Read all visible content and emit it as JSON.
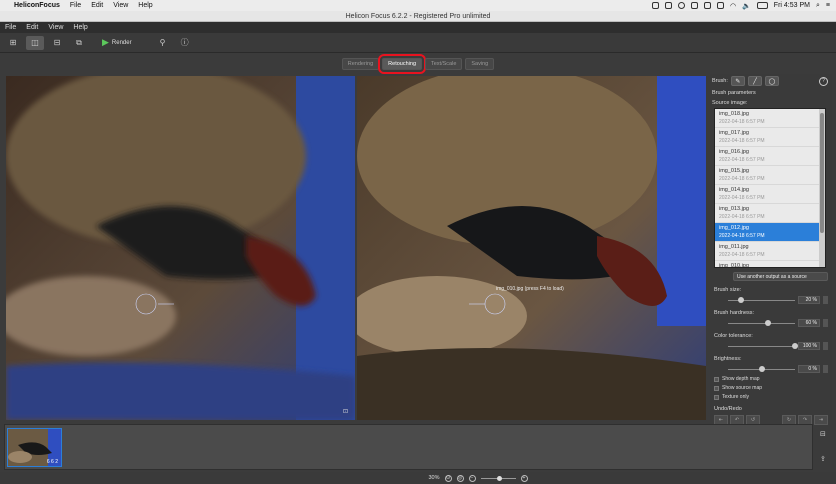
{
  "mac_menubar": {
    "app_name": "HeliconFocus",
    "menus": [
      "File",
      "Edit",
      "View",
      "Help"
    ],
    "clock": "Fri 4:53 PM"
  },
  "window": {
    "title": "Helicon Focus 6.2.2 - Registered Pro unlimited"
  },
  "app_menu": [
    "File",
    "Edit",
    "View",
    "Help"
  ],
  "toolbar": {
    "render_label": "Render"
  },
  "tabs": [
    {
      "label": "Rendering"
    },
    {
      "label": "Retouching",
      "selected": true
    },
    {
      "label": "Text/Scale"
    },
    {
      "label": "Saving"
    }
  ],
  "right_image_hint": "img_010.jpg (press F4 to load)",
  "panel": {
    "brush_label": "Brush:",
    "brush_parameters_title": "Brush parameters",
    "source_image_label": "Source image:",
    "sources": [
      {
        "name": "img_018.jpg",
        "date": "2022-04-18 6:57 PM"
      },
      {
        "name": "img_017.jpg",
        "date": "2022-04-18 6:57 PM"
      },
      {
        "name": "img_016.jpg",
        "date": "2022-04-18 6:57 PM"
      },
      {
        "name": "img_015.jpg",
        "date": "2022-04-18 6:57 PM"
      },
      {
        "name": "img_014.jpg",
        "date": "2022-04-18 6:57 PM"
      },
      {
        "name": "img_013.jpg",
        "date": "2022-04-18 6:57 PM"
      },
      {
        "name": "img_012.jpg",
        "date": "2022-04-18 6:57 PM",
        "selected": true
      },
      {
        "name": "img_011.jpg",
        "date": "2022-04-18 6:57 PM"
      },
      {
        "name": "img_010.jpg",
        "date": ""
      }
    ],
    "source_mode": "Use another output as a source",
    "brush_size_label": "Brush size:",
    "brush_size_value": "20 %",
    "brush_size_level": 0.2,
    "brush_hardness_label": "Brush hardness:",
    "brush_hardness_value": "60 %",
    "brush_hardness_level": 0.6,
    "color_tolerance_label": "Color tolerance:",
    "color_tolerance_value": "100 %",
    "color_tolerance_level": 1.0,
    "brightness_label": "Brightness:",
    "brightness_value": "0 %",
    "brightness_level": 0.5,
    "checks": [
      "Show depth map",
      "Show source map",
      "Texture only"
    ],
    "undo_redo_label": "Undo/Redo"
  },
  "filmstrip": {
    "thumb_label": "6 6 2"
  },
  "status": {
    "zoom": "30%"
  }
}
